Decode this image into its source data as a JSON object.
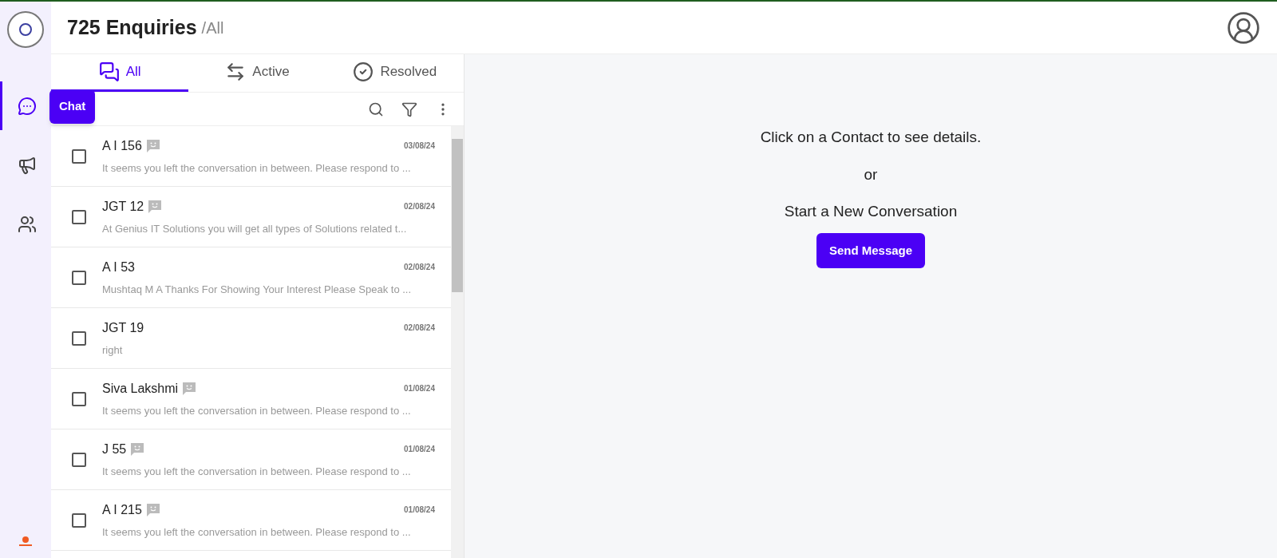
{
  "header": {
    "title": "725 Enquiries",
    "subtitle": "/All"
  },
  "nav": [
    {
      "kind": "chat",
      "selected": true
    },
    {
      "kind": "campaign",
      "selected": false
    },
    {
      "kind": "contacts",
      "selected": false
    }
  ],
  "tooltip": "Chat",
  "tabs": [
    {
      "kind": "all",
      "label": "All",
      "selected": true
    },
    {
      "kind": "active",
      "label": "Active",
      "selected": false
    },
    {
      "kind": "resolved",
      "label": "Resolved",
      "selected": false
    }
  ],
  "conversations": [
    {
      "name": "A I 156",
      "bot": true,
      "date": "03/08/24",
      "preview": "It seems you left the conversation in between. Please respond to ...",
      "checked": false
    },
    {
      "name": "JGT 12",
      "bot": true,
      "date": "02/08/24",
      "preview": "At Genius IT Solutions you will get all types of Solutions related t...",
      "checked": false
    },
    {
      "name": "A I 53",
      "bot": false,
      "date": "02/08/24",
      "preview": "Mushtaq M A Thanks For Showing Your Interest Please Speak to ...",
      "checked": false
    },
    {
      "name": "JGT 19",
      "bot": false,
      "date": "02/08/24",
      "preview": "right",
      "checked": false
    },
    {
      "name": "Siva Lakshmi",
      "bot": true,
      "date": "01/08/24",
      "preview": "It seems you left the conversation in between. Please respond to ...",
      "checked": false
    },
    {
      "name": "J 55",
      "bot": true,
      "date": "01/08/24",
      "preview": "It seems you left the conversation in between. Please respond to ...",
      "checked": false
    },
    {
      "name": "A I 215",
      "bot": true,
      "date": "01/08/24",
      "preview": "It seems you left the conversation in between. Please respond to ...",
      "checked": false
    }
  ],
  "empty_state": {
    "line_1": "Click on a Contact to see details.",
    "line_2": "or",
    "line_3": "Start a New Conversation",
    "button": "Send Message"
  }
}
